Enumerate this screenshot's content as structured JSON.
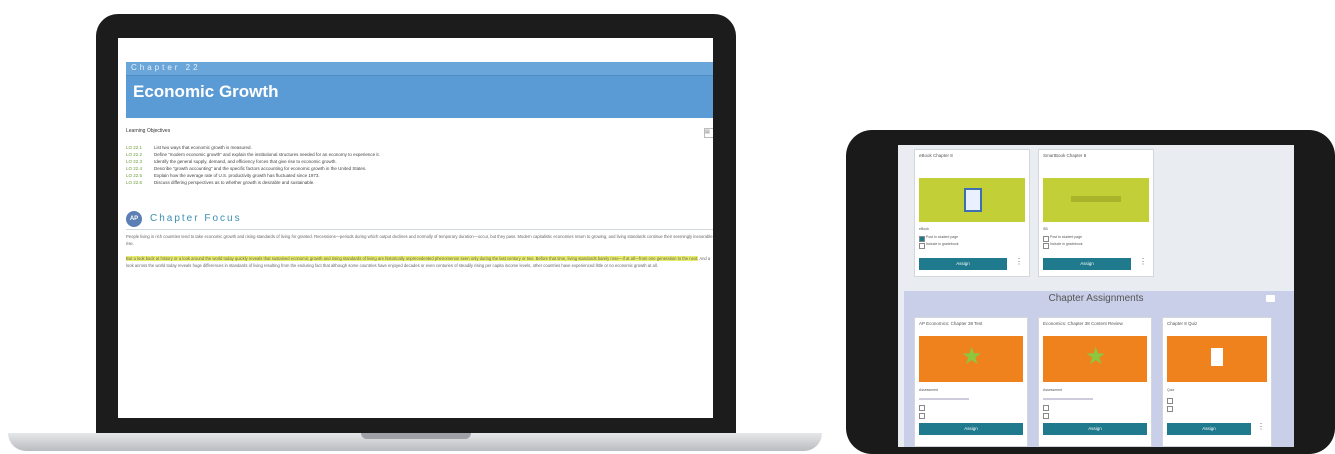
{
  "laptop": {
    "chapter_label": "Chapter 22",
    "chapter_title": "Economic Growth",
    "learning_objectives_title": "Learning Objectives",
    "objectives": [
      {
        "code": "LO 22.1",
        "text": "List two ways that economic growth is measured."
      },
      {
        "code": "LO 22.2",
        "text": "Define “modern economic growth” and explain the institutional structures needed for an economy to experience it."
      },
      {
        "code": "LO 22.3",
        "text": "Identify the general supply, demand, and efficiency forces that give rise to economic growth."
      },
      {
        "code": "LO 22.4",
        "text": "Describe “growth accounting” and the specific factors accounting for economic growth in the United States."
      },
      {
        "code": "LO 22.5",
        "text": "Explain how the average rate of U.S. productivity growth has fluctuated since 1973."
      },
      {
        "code": "LO 22.6",
        "text": "Discuss differing perspectives as to whether growth is desirable and sustainable."
      }
    ],
    "focus_icon": "AP",
    "focus_title": "Chapter Focus",
    "paragraph1": "People living in rich countries tend to take economic growth and rising standards of living for granted. Recessions—periods during which output declines and normally of temporary duration—occur, but they pass. Modern capitalistic economies return to growing, and living standards continue their seemingly inexorable rise.",
    "paragraph2_highlight": "But a look back at history or a look around the world today quickly reveals that sustained economic growth and rising standards of living are historically unprecedented phenomenon seen only during the last century or two. Before that time, living standards barely rose—if at all—from one generation to the next.",
    "paragraph2_rest": "And a look across the world today reveals huge differences in standards of living resulting from the enduring fact that although some countries have enjoyed decades or even centuries of steadily rising per capita income levels, other countries have experienced little or no economic growth at all."
  },
  "tablet": {
    "top_cards": [
      {
        "title": "eBook Chapter 8",
        "meta": "eBook",
        "line1": "Post to student page",
        "line2": "Include in gradebook",
        "button": "Assign"
      },
      {
        "title": "SmartBook Chapter 8",
        "meta": "SB",
        "line1": "Post to student page",
        "line2": "Include in gradebook",
        "button": "Assign"
      }
    ],
    "section_title": "Chapter Assignments",
    "bottom_cards": [
      {
        "title": "AP Economics: Chapter 38 Test",
        "meta": "Assessment",
        "button": "Assign"
      },
      {
        "title": "Economics: Chapter 38 Content Review",
        "meta": "Assessment",
        "button": "Assign"
      },
      {
        "title": "Chapter 8 Quiz",
        "meta": "Quiz",
        "button": "Assign"
      }
    ]
  },
  "colors": {
    "band_blue": "#5b9bd5",
    "assign_teal": "#1e7a8c",
    "lime_tile": "#c3cf36",
    "orange_tile": "#f0821e",
    "highlight": "#e8ee6a"
  }
}
